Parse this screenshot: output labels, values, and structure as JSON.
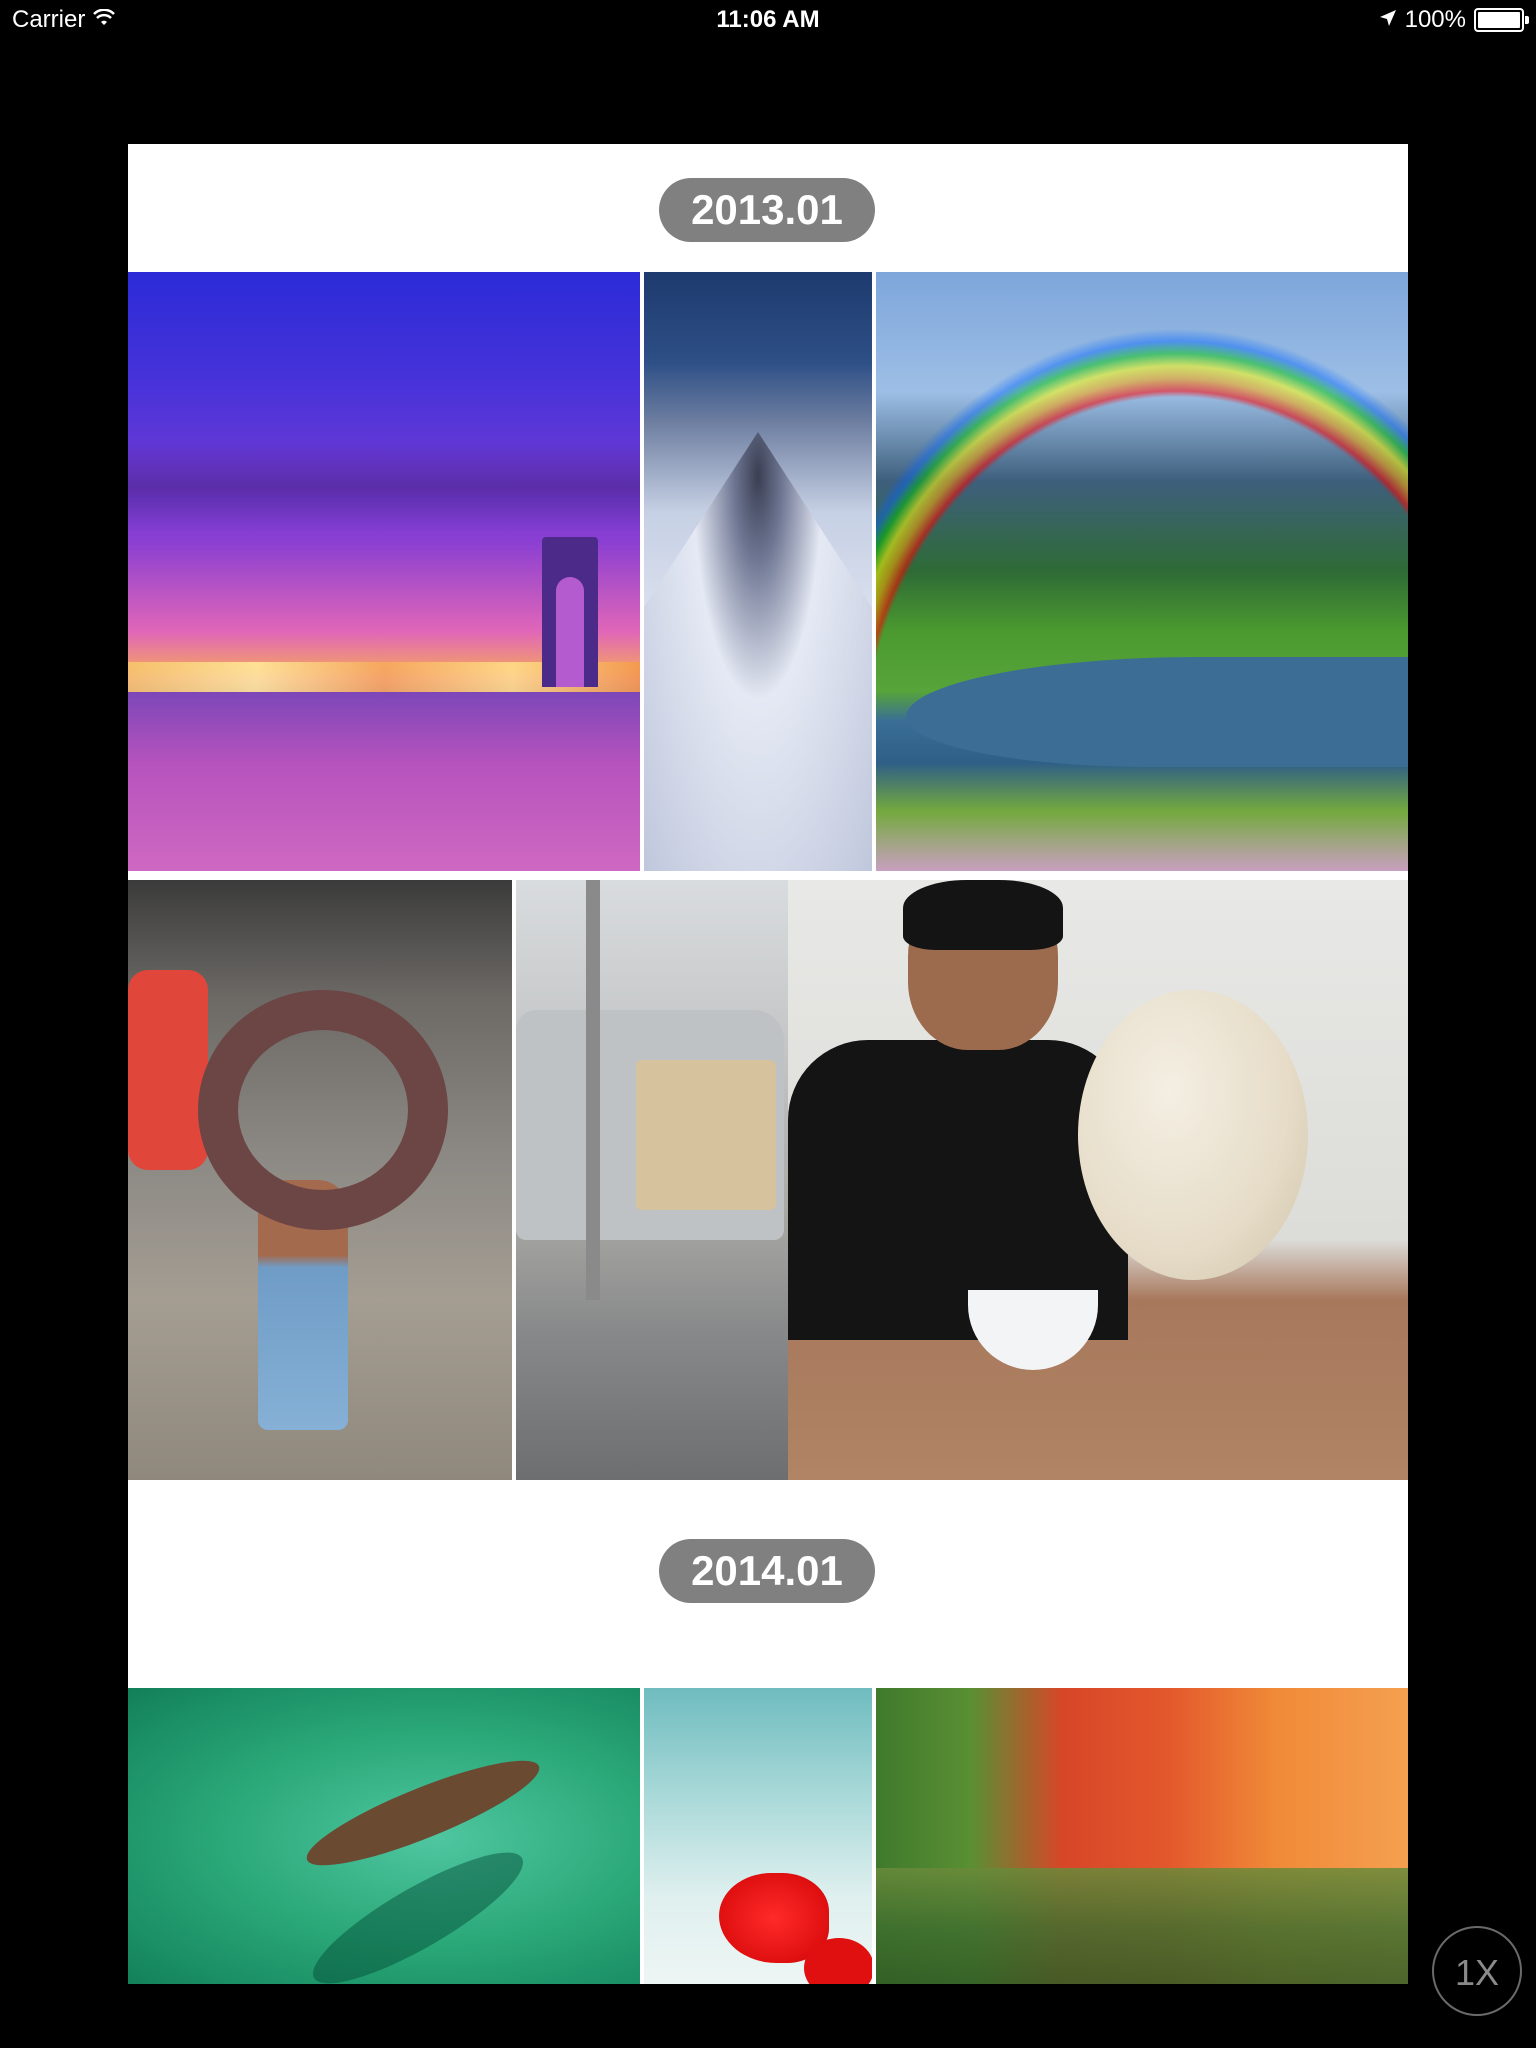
{
  "status_bar": {
    "carrier": "Carrier",
    "time": "11:06 AM",
    "battery": "100%",
    "icons": [
      "wifi-icon",
      "location-icon",
      "battery-icon"
    ]
  },
  "sections": [
    {
      "date": "2013.01",
      "photos": [
        "city-skyline-photo",
        "snowy-volcano-photo",
        "rainbow-meadow-photo",
        "tire-carrier-photo",
        "van-goats-photo",
        "man-eating-bun-photo"
      ]
    },
    {
      "date": "2014.01",
      "photos": [
        "canoe-photo",
        "red-poppy-photo",
        "autumn-garden-photo"
      ]
    }
  ],
  "zoom_button": {
    "label": "1X"
  },
  "colors": {
    "background": "#000000",
    "panel": "#ffffff",
    "date_pill": "#808080",
    "date_text": "#ffffff",
    "zoom_button_border": "#6a6a6a"
  }
}
